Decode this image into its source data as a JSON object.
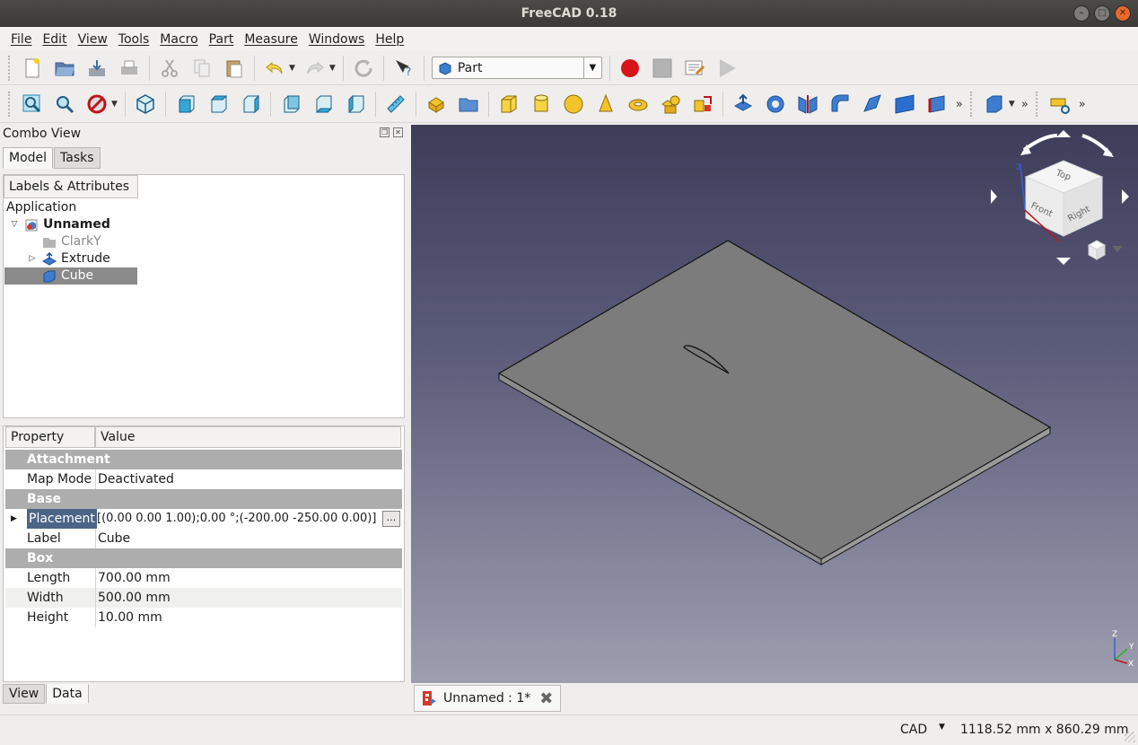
{
  "window": {
    "title": "FreeCAD 0.18"
  },
  "menu": [
    "File",
    "Edit",
    "View",
    "Tools",
    "Macro",
    "Part",
    "Measure",
    "Windows",
    "Help"
  ],
  "workbench": {
    "selected": "Part"
  },
  "combo": {
    "title": "Combo View",
    "tabs": [
      "Model",
      "Tasks"
    ],
    "tree_header": "Labels & Attributes",
    "tree": {
      "root": "Application",
      "document": "Unnamed",
      "items": [
        "ClarkY",
        "Extrude",
        "Cube"
      ]
    },
    "property_headers": [
      "Property",
      "Value"
    ],
    "properties": {
      "group_attachment": "Attachment",
      "map_mode_key": "Map Mode",
      "map_mode_val": "Deactivated",
      "group_base": "Base",
      "placement_key": "Placement",
      "placement_val": "[(0.00 0.00 1.00);0.00 °;(-200.00 -250.00 0.00)]",
      "ellipsis": "...",
      "label_key": "Label",
      "label_val": "Cube",
      "group_box": "Box",
      "length_key": "Length",
      "length_val": "700.00 mm",
      "width_key": "Width",
      "width_val": "500.00 mm",
      "height_key": "Height",
      "height_val": "10.00 mm"
    },
    "bottom_tabs": [
      "View",
      "Data"
    ]
  },
  "navcube": {
    "top": "Top",
    "front": "Front",
    "right": "Right"
  },
  "axis": {
    "z": "Z",
    "y": "Y",
    "x": "X"
  },
  "document_tab": {
    "label": "Unnamed : 1*"
  },
  "status": {
    "nav_style": "CAD",
    "dimensions": "1118.52 mm x 860.29 mm"
  },
  "colors": {
    "selection": "#4b6587",
    "tree_selection": "#8a8a8a",
    "viewport_top": "#3d3d5a",
    "viewport_bottom": "#9e9eb0",
    "record": "#d7141a"
  }
}
